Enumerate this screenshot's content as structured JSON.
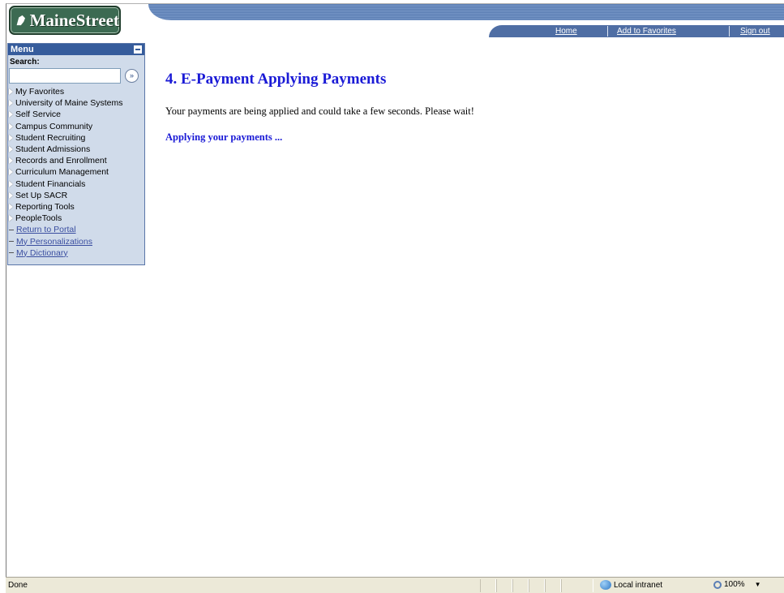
{
  "logo": {
    "text": "MaineStreet"
  },
  "nav": {
    "home": "Home",
    "favorites": "Add to Favorites",
    "signout": "Sign out"
  },
  "menu": {
    "title": "Menu",
    "search_label": "Search:",
    "search_value": "",
    "items": [
      {
        "label": "My Favorites",
        "kind": "folder"
      },
      {
        "label": "University of Maine Systems",
        "kind": "folder"
      },
      {
        "label": "Self Service",
        "kind": "folder"
      },
      {
        "label": "Campus Community",
        "kind": "folder"
      },
      {
        "label": "Student Recruiting",
        "kind": "folder"
      },
      {
        "label": "Student Admissions",
        "kind": "folder"
      },
      {
        "label": "Records and Enrollment",
        "kind": "folder"
      },
      {
        "label": "Curriculum Management",
        "kind": "folder"
      },
      {
        "label": "Student Financials",
        "kind": "folder"
      },
      {
        "label": "Set Up SACR",
        "kind": "folder"
      },
      {
        "label": "Reporting Tools",
        "kind": "folder"
      },
      {
        "label": "PeopleTools",
        "kind": "folder"
      },
      {
        "label": "Return to Portal",
        "kind": "link"
      },
      {
        "label": "My Personalizations",
        "kind": "link"
      },
      {
        "label": "My Dictionary",
        "kind": "link"
      }
    ]
  },
  "content": {
    "title": "4. E-Payment Applying Payments",
    "message": "Your payments are being applied and could take a few seconds. Please wait!",
    "status": "Applying your payments ..."
  },
  "statusbar": {
    "left": "Done",
    "zone": "Local intranet",
    "zoom": "100%"
  },
  "colors": {
    "title_blue": "#1a1ad6",
    "menu_header": "#365c9c",
    "menu_bg": "#d0dbea",
    "logo_green": "#3c6a52"
  }
}
